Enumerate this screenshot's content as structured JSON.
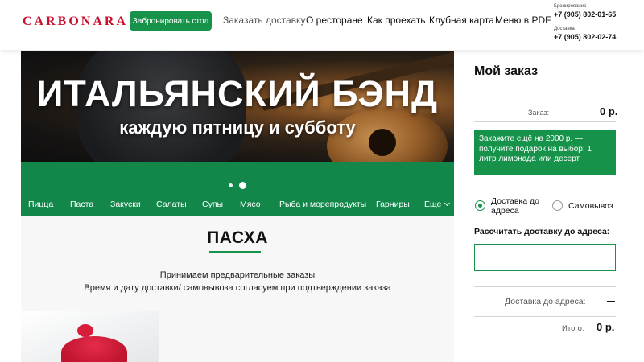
{
  "header": {
    "logo": "CARBONARA",
    "book_button": "Забронировать стол",
    "nav": [
      "Заказать доставку",
      "О ресторане",
      "Как проехать",
      "Клубная карта",
      "Меню в PDF"
    ],
    "phones": [
      {
        "label": "Бронирование",
        "number": "+7 (905) 802-01-65"
      },
      {
        "label": "Доставка",
        "number": "+7 (905) 802-02-74"
      }
    ]
  },
  "banner": {
    "title": "ИТАЛЬЯНСКИЙ БЭНД",
    "subtitle": "каждую пятницу и субботу",
    "slides_count": 2,
    "active_slide": 2
  },
  "categories": [
    "Пицца",
    "Паста",
    "Закуски",
    "Салаты",
    "Супы",
    "Мясо",
    "Рыба и морепродукты",
    "Гарниры",
    "Еще"
  ],
  "section": {
    "title": "ПАСХА",
    "line1": "Принимаем предварительные заказы",
    "line2": "Время и дату доставки/ самовывоза согласуем при подтверждении заказа"
  },
  "order": {
    "title": "Мой заказ",
    "sum_label": "Заказ:",
    "sum_value": "0 р.",
    "promo": "Закажите ещё на 2000 р. — получите подарок на выбор: 1 литр лимонада или десерт",
    "option_delivery": "Доставка до адреса",
    "option_pickup": "Самовывоз",
    "selected_option": "delivery",
    "calc_label": "Рассчитать доставку до адреса:",
    "address_value": "",
    "delivery_label": "Доставка до адреса:",
    "total_label": "Итого:",
    "total_value": "0 р."
  },
  "colors": {
    "brand_red": "#c8102e",
    "brand_green": "#17924a",
    "category_bar": "#13874a"
  }
}
